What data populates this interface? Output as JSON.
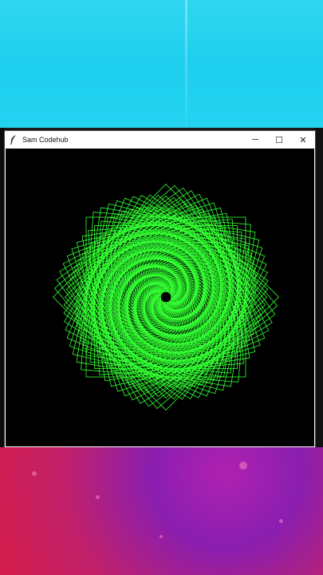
{
  "window": {
    "title": "Sam Codehub",
    "controls": {
      "minimize": "─",
      "maximize": "☐",
      "close": "✕"
    }
  },
  "canvas": {
    "background_color": "#000000",
    "stroke_color": "#33ff33",
    "arms": 8,
    "squares": 90
  },
  "background": {
    "top_color": "#22d3ef",
    "bottom_colors": [
      "#b020b0",
      "#d51d4a"
    ]
  }
}
